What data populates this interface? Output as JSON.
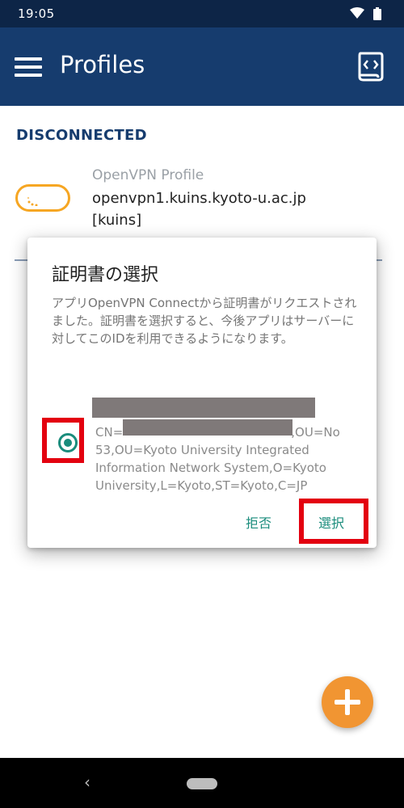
{
  "status_bar": {
    "time": "19:05",
    "icons": [
      "wifi-icon",
      "battery-icon"
    ]
  },
  "app_bar": {
    "title": "Profiles",
    "menu_icon": "hamburger-menu-icon",
    "action_icon": "import-profile-icon"
  },
  "connection_status": "DISCONNECTED",
  "profile": {
    "type": "OpenVPN Profile",
    "host": "openvpn1.kuins.kyoto-u.ac.jp",
    "user": "[kuins]"
  },
  "dialog": {
    "title": "証明書の選択",
    "message": "アプリOpenVPN Connectから証明書がリクエストされました。証明書を選択すると、今後アプリはサーバーに対してこのIDを利用できるようになります。",
    "certificate": {
      "cn_prefix": "CN=",
      "cn_suffix": ",OU=No",
      "line2": "53,OU=Kyoto University Integrated",
      "line3": "Information Network System,O=Kyoto",
      "line4": "University,L=Kyoto,ST=Kyoto,C=JP",
      "selected": true
    },
    "deny_button": "拒否",
    "select_button": "選択"
  },
  "colors": {
    "status_bar": "#0d2547",
    "app_bar": "#163c6e",
    "accent_teal": "#1a8c7c",
    "fab_orange": "#f19532",
    "highlight_red": "#e3000f",
    "toggle_orange": "#f6a623"
  }
}
